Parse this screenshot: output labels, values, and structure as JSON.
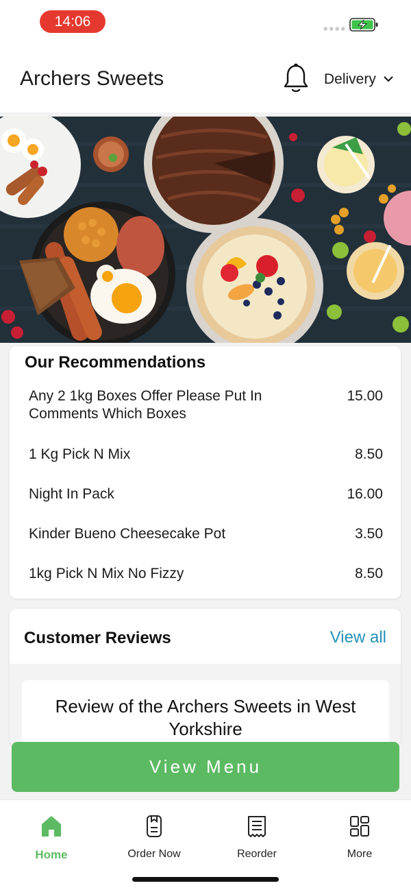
{
  "status": {
    "time": "14:06"
  },
  "header": {
    "title": "Archers Sweets",
    "delivery_label": "Delivery"
  },
  "recommendations": {
    "title": "Our Recommendations",
    "items": [
      {
        "name": "Any 2 1kg Boxes Offer Please Put In Comments Which Boxes",
        "price": "15.00"
      },
      {
        "name": "1 Kg Pick N Mix",
        "price": "8.50"
      },
      {
        "name": "Night In Pack",
        "price": "16.00"
      },
      {
        "name": "Kinder Bueno Cheesecake Pot",
        "price": "3.50"
      },
      {
        "name": "1kg Pick N Mix No Fizzy",
        "price": "8.50"
      }
    ]
  },
  "reviews": {
    "title": "Customer Reviews",
    "view_all": "View all",
    "review_heading": "Review of the Archers Sweets in West Yorkshire"
  },
  "cta": {
    "label": "View Menu"
  },
  "nav": {
    "items": [
      {
        "label": "Home",
        "icon": "home-icon",
        "active": true
      },
      {
        "label": "Order Now",
        "icon": "order-icon",
        "active": false
      },
      {
        "label": "Reorder",
        "icon": "receipt-icon",
        "active": false
      },
      {
        "label": "More",
        "icon": "grid-icon",
        "active": false
      }
    ]
  },
  "colors": {
    "accent": "#5cba62",
    "link": "#2491b5",
    "time_pill": "#e5392f"
  }
}
